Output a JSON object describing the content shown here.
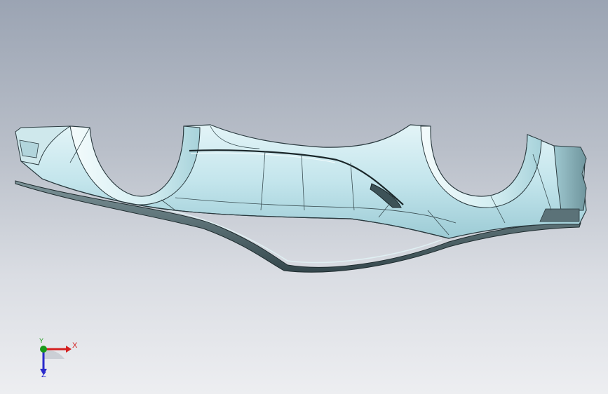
{
  "viewport": {
    "background_top": "#9ba4b3",
    "background_bottom": "#edeef1"
  },
  "model": {
    "name": "car-bumper-model",
    "surface_color": "#bfe3ea",
    "edge_color": "#2a3a3f",
    "shadow_color": "#4e5e62"
  },
  "triad": {
    "x_label": "X",
    "y_label": "Y",
    "z_label": "Z",
    "x_color": "#d42020",
    "y_color": "#1a9a1a",
    "z_color": "#2a2acc"
  }
}
